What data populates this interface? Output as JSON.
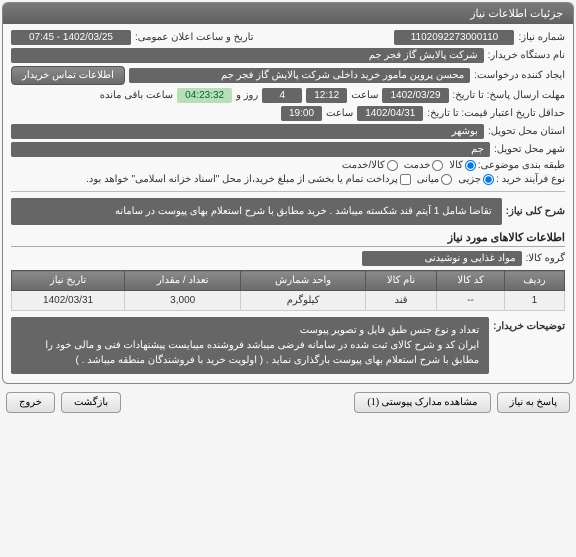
{
  "panel": {
    "title": "جزئیات اطلاعات نیاز"
  },
  "fields": {
    "needNo": {
      "label": "شماره نیاز:",
      "value": "1102092273000110"
    },
    "announceDateTime": {
      "label": "تاریخ و ساعت اعلان عمومی:",
      "value": "1402/03/25 - 07:45"
    },
    "buyerOrg": {
      "label": "نام دستگاه خریدار:",
      "value": "شرکت پالایش گاز فجر جم"
    },
    "requester": {
      "label": "ایجاد کننده درخواست:",
      "value": "محسن پروین مامور خرید داخلی شرکت پالایش گاز فجر جم"
    },
    "contactBtn": "اطلاعات تماس خریدار",
    "deadline": {
      "label": "مهلت ارسال پاسخ: تا تاریخ:",
      "date": "1402/03/29",
      "timeLabel": "ساعت",
      "time": "12:12",
      "dayLabel": "روز و",
      "days": "4",
      "countdown": "04:23:32",
      "remainLabel": "ساعت باقی مانده"
    },
    "validity": {
      "label": "حداقل تاریخ اعتبار قیمت: تا تاریخ:",
      "date": "1402/04/31",
      "timeLabel": "ساعت",
      "time": "19:00"
    },
    "province": {
      "label": "استان محل تحویل:",
      "value": "بوشهر"
    },
    "city": {
      "label": "شهر محل تحویل:",
      "value": "جم"
    },
    "budget": {
      "label": "طبقه بندی موضوعی:",
      "opts": [
        "کالا",
        "خدمت",
        "کالا/خدمت"
      ],
      "selected": 0
    },
    "buyType": {
      "label": "نوع فرآیند خرید :",
      "opts": [
        "جزیی",
        "میانی"
      ],
      "selected": 0,
      "note": "پرداخت تمام یا بخشی از مبلغ خرید،از محل \"اسناد خزانه اسلامی\" خواهد بود."
    },
    "needDesc": {
      "label": "شرح کلی نیاز:",
      "value": "تقاضا شامل 1 آیتم قند شکسته  میباشد .  خرید مطابق با شرح استعلام بهای پیوست در سامانه"
    },
    "goodsSection": "اطلاعات کالاهای مورد نیاز",
    "goodsGroup": {
      "label": "گروه کالا:",
      "value": "مواد غذایی و نوشیدنی"
    },
    "table": {
      "headers": [
        "ردیف",
        "کد کالا",
        "نام کالا",
        "واحد شمارش",
        "تعداد / مقدار",
        "تاریخ نیاز"
      ],
      "rows": [
        {
          "idx": "1",
          "code": "--",
          "name": "قند",
          "unit": "کیلوگرم",
          "qty": "3,000",
          "date": "1402/03/31"
        }
      ]
    },
    "buyerNotes": {
      "label": "توضیحات خریدار:",
      "value": "تعداد و نوع جنس طبق فایل و تصویر پیوست\nایران کد و شرح کالای ثبت شده در سامانه فرضی میباشد فروشنده میبایست پیشنهادات فنی و مالی  خود  را مطابق با شرح  استعلام بهای پیوست بارگذاری نماید .   (   اولویت خرید با فروشندگان منطقه میباشد . )"
    }
  },
  "buttons": {
    "reply": "پاسخ به نیاز",
    "attachments": "مشاهده مدارک پیوستی (1)",
    "back": "بازگشت",
    "exit": "خروج"
  }
}
